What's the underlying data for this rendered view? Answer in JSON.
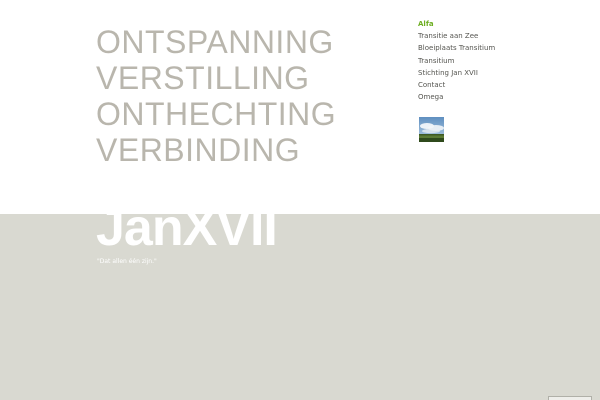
{
  "intro_words": [
    "ONTSPANNING",
    "VERSTILLING",
    "ONTHECHTING",
    "VERBINDING"
  ],
  "nav": {
    "items": [
      {
        "label": "Alfa",
        "active": true
      },
      {
        "label": "Transitie aan Zee",
        "active": false
      },
      {
        "label": "Bloeiplaats Transitium",
        "active": false
      },
      {
        "label": "Transitium",
        "active": false
      },
      {
        "label": "Stichting Jan XVII",
        "active": false
      },
      {
        "label": "Contact",
        "active": false
      },
      {
        "label": "Omega",
        "active": false
      }
    ]
  },
  "brand": {
    "name": "JanXVII",
    "tagline": "\"Dat allen één zijn.\""
  },
  "colors": {
    "intro_text": "#b9b6ad",
    "nav_text": "#555550",
    "nav_active": "#6dae22",
    "band_background": "#d9d9d1",
    "brand_text": "#ffffff"
  },
  "icons": {
    "thumbnail": "landscape-thumbnail-icon"
  }
}
